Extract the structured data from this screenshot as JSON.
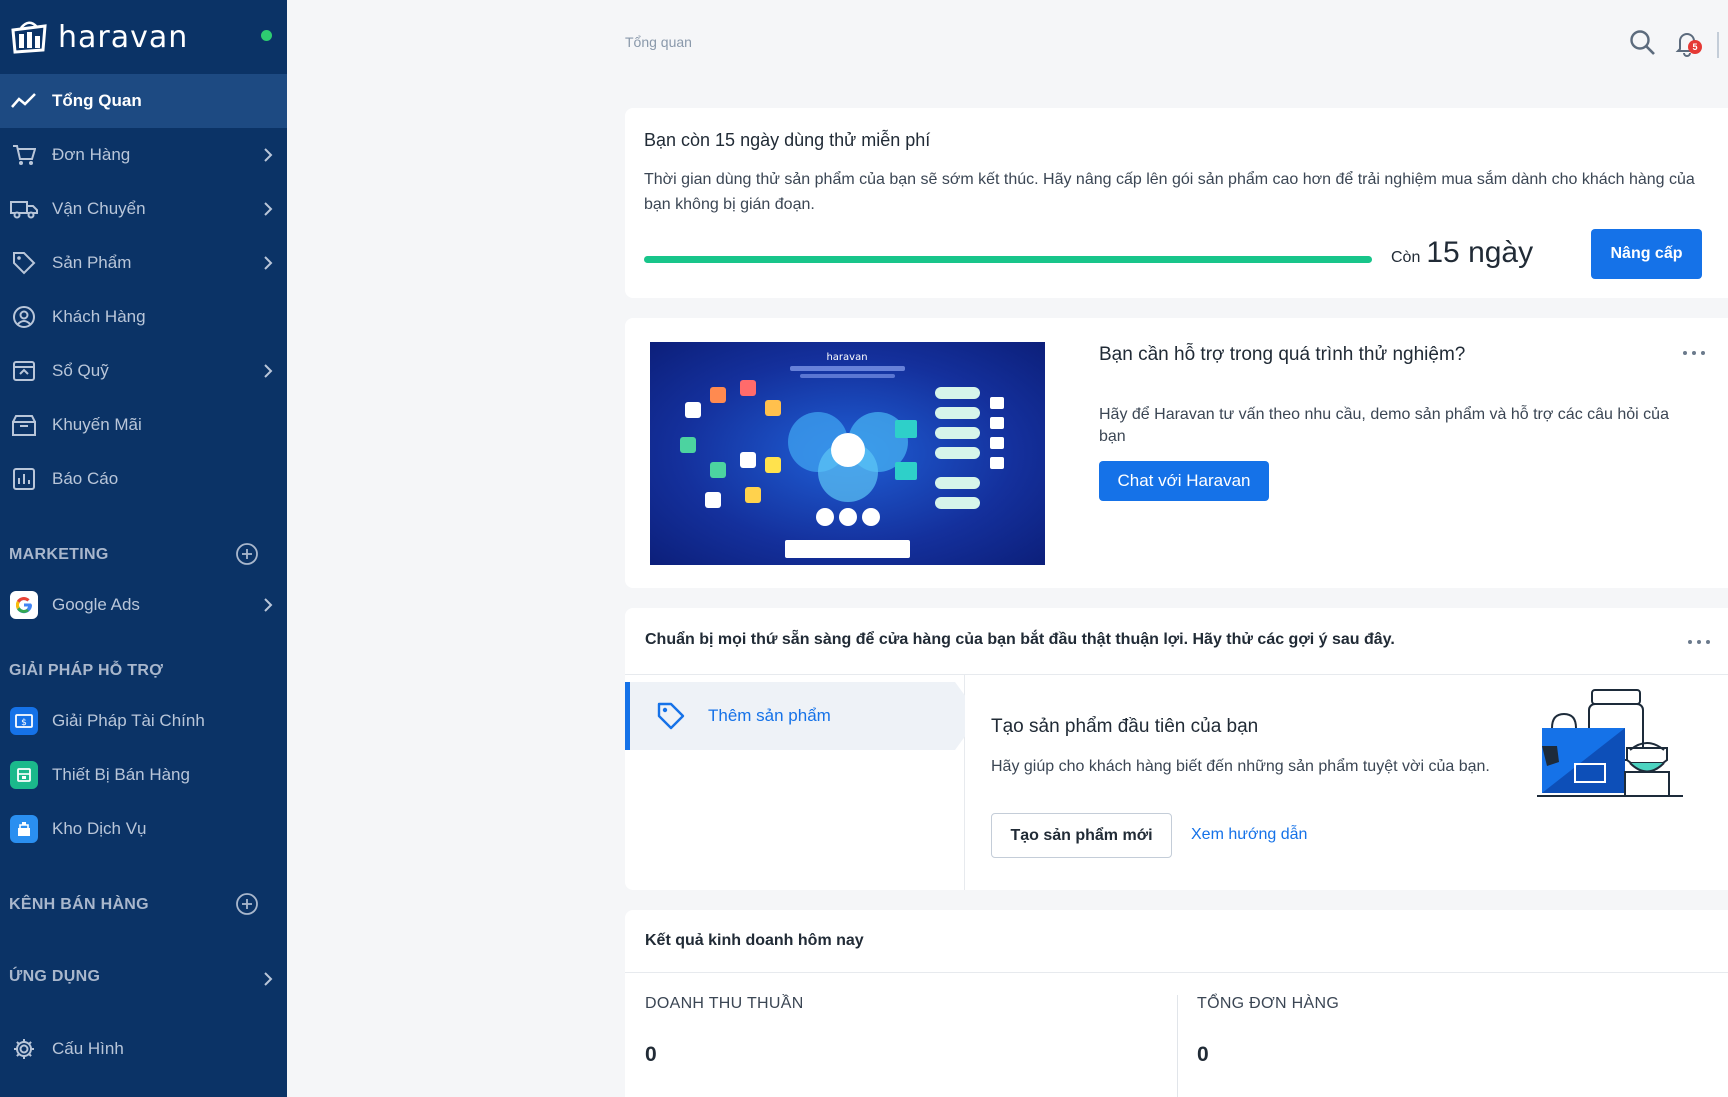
{
  "app": {
    "brand": "haravan"
  },
  "sidebar": {
    "items": [
      {
        "label": "Tổng Quan",
        "active": true,
        "icon": "trend-line-icon"
      },
      {
        "label": "Đơn Hàng",
        "icon": "cart-icon",
        "has_children": true
      },
      {
        "label": "Vận Chuyển",
        "icon": "truck-icon",
        "has_children": true
      },
      {
        "label": "Sản Phẩm",
        "icon": "tag-icon",
        "has_children": true
      },
      {
        "label": "Khách Hàng",
        "icon": "user-circle-icon"
      },
      {
        "label": "Sổ Quỹ",
        "icon": "cashbook-icon",
        "has_children": true
      },
      {
        "label": "Khuyến Mãi",
        "icon": "gift-icon"
      },
      {
        "label": "Báo Cáo",
        "icon": "report-icon"
      }
    ],
    "marketing": {
      "title": "MARKETING",
      "items": [
        {
          "label": "Google Ads",
          "icon": "google-icon",
          "has_children": true
        }
      ]
    },
    "support": {
      "title": "GIẢI PHÁP HỖ TRỢ",
      "items": [
        {
          "label": "Giải Pháp Tài Chính",
          "icon": "finance-icon",
          "color": "#1572e8"
        },
        {
          "label": "Thiết Bị Bán Hàng",
          "icon": "pos-device-icon",
          "color": "#1bb98b"
        },
        {
          "label": "Kho Dịch Vụ",
          "icon": "service-store-icon",
          "color": "#2a8ff0"
        }
      ]
    },
    "channels": {
      "title": "KÊNH BÁN HÀNG"
    },
    "apps": {
      "title": "ỨNG DỤNG"
    },
    "settings": {
      "label": "Cấu Hình",
      "icon": "gear-icon"
    }
  },
  "header": {
    "breadcrumb": "Tổng quan",
    "notification_count": "5"
  },
  "trial": {
    "title": "Bạn còn 15 ngày dùng thử miễn phí",
    "description": "Thời gian dùng thử sản phẩm của bạn sẽ sớm kết thúc. Hãy nâng cấp lên gói sản phẩm cao hơn để trải nghiệm mua sắm dành cho khách hàng của bạn không bị gián đoạn.",
    "progress": 1.0,
    "remain_prefix": "Còn",
    "remain_value": "15 ngày",
    "upgrade_label": "Nâng cấp"
  },
  "support_card": {
    "title": "Bạn cần hỗ trợ trong quá trình thử nghiệm?",
    "description": "Hãy để Haravan tư vấn theo nhu cầu, demo sản phẩm và hỗ trợ các câu hỏi của bạn",
    "chat_label": "Chat với Haravan",
    "image_brand": "haravan"
  },
  "guide": {
    "heading": "Chuẩn bị mọi thứ sẵn sàng để cửa hàng của bạn bắt đầu thật thuận lợi. Hãy thử các gợi ý sau đây.",
    "tab_label": "Thêm sản phẩm",
    "main_title": "Tạo sản phẩm đầu tiên của bạn",
    "main_desc": "Hãy giúp cho khách hàng biết đến những sản phẩm tuyệt vời của bạn.",
    "create_label": "Tạo sản phẩm mới",
    "guide_link": "Xem hướng dẫn"
  },
  "results": {
    "title": "Kết quả kinh doanh hôm nay",
    "metrics": [
      {
        "label": "DOANH THU THUẦN",
        "value": "0"
      },
      {
        "label": "TỔNG ĐƠN HÀNG",
        "value": "0"
      }
    ]
  },
  "colors": {
    "sidebar": "#0b3366",
    "accent": "#1572e8",
    "progress": "#18c58a",
    "online": "#2ecc71"
  }
}
